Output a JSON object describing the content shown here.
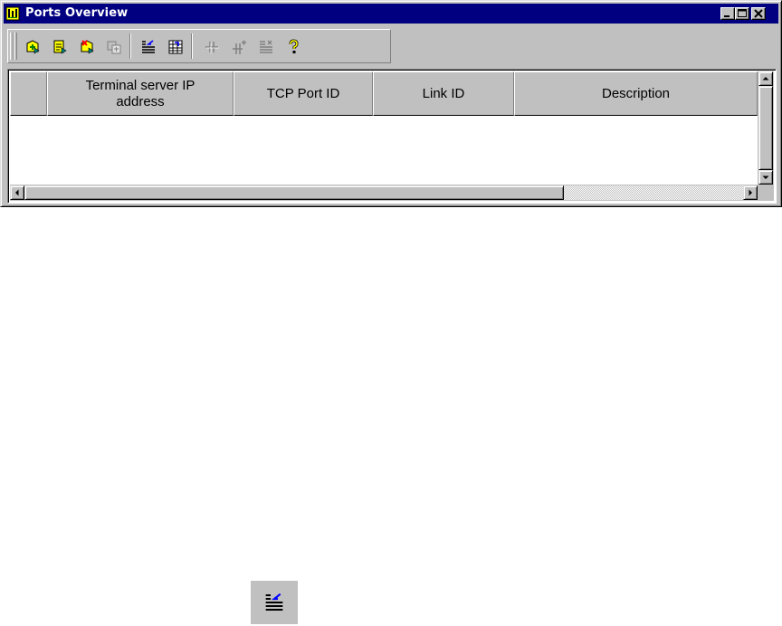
{
  "window": {
    "title": "Ports Overview"
  },
  "toolbar": {
    "buttons": [
      {
        "icon": "new-record-icon",
        "enabled": true
      },
      {
        "icon": "edit-record-icon",
        "enabled": true
      },
      {
        "icon": "delete-record-icon",
        "enabled": true
      },
      {
        "icon": "copy-record-icon",
        "enabled": false
      },
      {
        "icon": "import-list-icon",
        "enabled": true
      },
      {
        "icon": "export-list-icon",
        "enabled": true
      },
      {
        "icon": "connect-port-icon",
        "enabled": false
      },
      {
        "icon": "add-port-icon",
        "enabled": false
      },
      {
        "icon": "list-properties-icon",
        "enabled": false
      },
      {
        "icon": "help-icon",
        "enabled": true
      }
    ]
  },
  "table": {
    "columns": [
      "Terminal server IP address",
      "TCP Port ID",
      "Link ID",
      "Description"
    ],
    "rows": []
  },
  "colors": {
    "titlebar": "#000080",
    "face": "#c0c0c0",
    "shadow": "#808080",
    "highlight": "#ffffff"
  }
}
